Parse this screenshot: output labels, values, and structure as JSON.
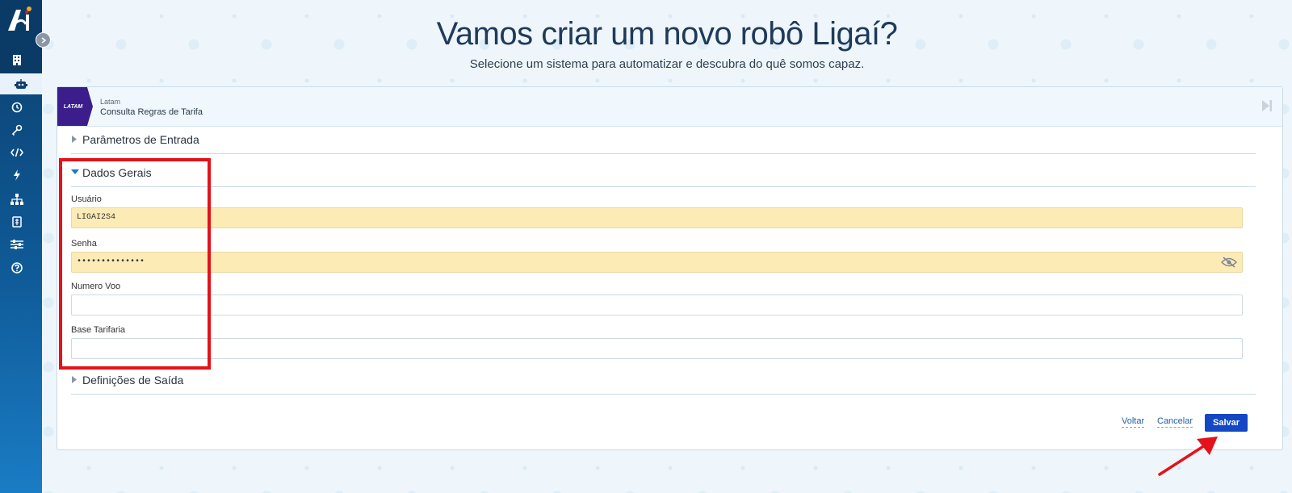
{
  "header": {
    "title": "Vamos criar um novo robô Ligaí?",
    "subtitle": "Selecione um sistema para automatizar e descubra do quê somos capaz."
  },
  "sidebar": {
    "items": [
      {
        "icon": "building-icon"
      },
      {
        "icon": "robot-icon",
        "active": true
      },
      {
        "icon": "history-icon"
      },
      {
        "icon": "key-icon"
      },
      {
        "icon": "code-icon"
      },
      {
        "icon": "lightning-icon"
      },
      {
        "icon": "sitemap-icon"
      },
      {
        "icon": "invoice-icon"
      },
      {
        "icon": "sliders-icon"
      },
      {
        "icon": "help-icon"
      }
    ]
  },
  "card": {
    "brand": "LATAM",
    "provider": "Latam",
    "robot_name": "Consulta Regras de Tarifa",
    "sections": {
      "input": "Parâmetros de Entrada",
      "general": "Dados Gerais",
      "output": "Definições de Saída"
    },
    "fields": {
      "usuario": {
        "label": "Usuário",
        "value": "LIGAI2S4"
      },
      "senha": {
        "label": "Senha",
        "value": "••••••••••••••"
      },
      "numero_voo": {
        "label": "Numero Voo",
        "value": ""
      },
      "base_tarifaria": {
        "label": "Base Tarifaria",
        "value": ""
      }
    },
    "actions": {
      "back": "Voltar",
      "cancel": "Cancelar",
      "save": "Salvar"
    }
  },
  "colors": {
    "sidebar": "#0f5a97",
    "save_button": "#1447c4",
    "highlight": "#e3121b",
    "filled_field": "#fdebb6"
  }
}
